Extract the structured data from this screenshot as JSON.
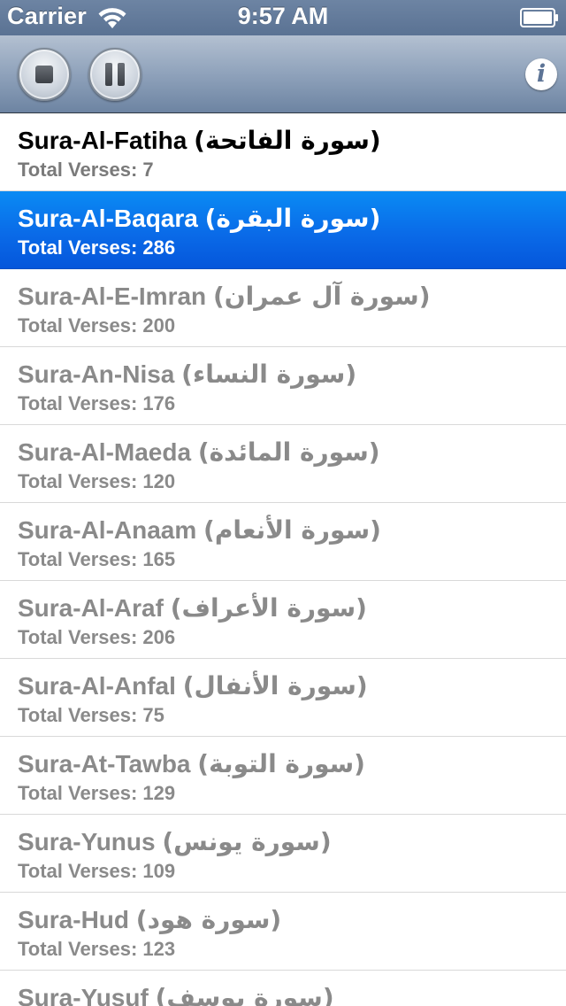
{
  "status_bar": {
    "carrier": "Carrier",
    "time": "9:57 AM"
  },
  "toolbar": {
    "stop_icon": "stop-icon",
    "pause_icon": "pause-icon",
    "info_label": "i"
  },
  "colors": {
    "selected_row": "#0a6be8",
    "toolbar": "#8fa2bb",
    "status_bar": "#6d84a3"
  },
  "suras": [
    {
      "name": "Sura-Al-Fatiha",
      "arabic": "(سورة الفاتحة)",
      "verses": "Total Verses: 7"
    },
    {
      "name": "Sura-Al-Baqara",
      "arabic": "(سورة البقرة)",
      "verses": "Total Verses: 286"
    },
    {
      "name": "Sura-Al-E-Imran",
      "arabic": "(سورة آل عمران)",
      "verses": "Total Verses: 200"
    },
    {
      "name": "Sura-An-Nisa",
      "arabic": "(سورة النساء)",
      "verses": "Total Verses: 176"
    },
    {
      "name": "Sura-Al-Maeda",
      "arabic": "(سورة المائدة)",
      "verses": "Total Verses: 120"
    },
    {
      "name": "Sura-Al-Anaam",
      "arabic": "(سورة الأنعام)",
      "verses": "Total Verses: 165"
    },
    {
      "name": "Sura-Al-Araf",
      "arabic": "(سورة الأعراف)",
      "verses": "Total Verses: 206"
    },
    {
      "name": "Sura-Al-Anfal",
      "arabic": "(سورة الأنفال)",
      "verses": "Total Verses: 75"
    },
    {
      "name": "Sura-At-Tawba",
      "arabic": "(سورة التوبة)",
      "verses": "Total Verses: 129"
    },
    {
      "name": "Sura-Yunus",
      "arabic": "(سورة يونس)",
      "verses": "Total Verses: 109"
    },
    {
      "name": "Sura-Hud",
      "arabic": "(سورة هود)",
      "verses": "Total Verses: 123"
    },
    {
      "name": "Sura-Yusuf",
      "arabic": "(سورة يوسف)",
      "verses": ""
    }
  ]
}
